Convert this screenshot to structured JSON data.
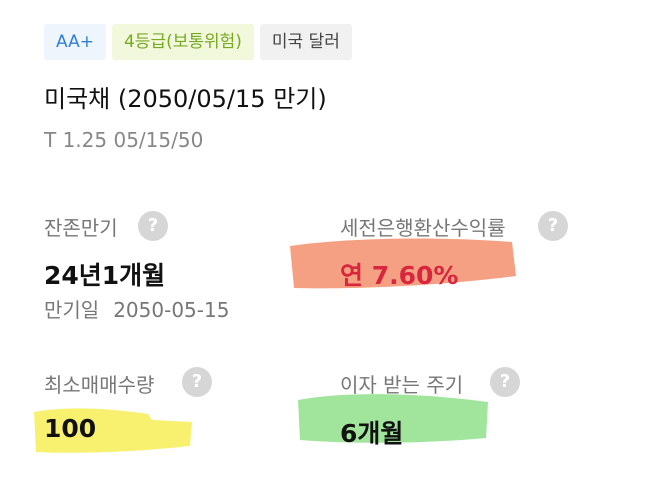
{
  "badges": {
    "rating": "AA+",
    "risk": "4등급(보통위험)",
    "currency": "미국 달러"
  },
  "bond": {
    "title": "미국채 (2050/05/15 만기)",
    "ticker": "T 1.25 05/15/50"
  },
  "fields": {
    "remaining_maturity": {
      "label": "잔존만기",
      "value": "24년1개월",
      "maturity_date_label": "만기일",
      "maturity_date": "2050-05-15"
    },
    "yield": {
      "label": "세전은행환산수익률",
      "value": "연 7.60%"
    },
    "min_quantity": {
      "label": "최소매매수량",
      "value": "100"
    },
    "interest_period": {
      "label": "이자 받는 주기",
      "value": "6개월"
    }
  },
  "help_glyph": "?",
  "colors": {
    "rating_text": "#2f7fd6",
    "risk_text": "#78a923",
    "yield_value": "#d7263d",
    "highlight_orange": "#f58f6d",
    "highlight_yellow": "#f7f060",
    "highlight_green": "#8fe08a"
  }
}
